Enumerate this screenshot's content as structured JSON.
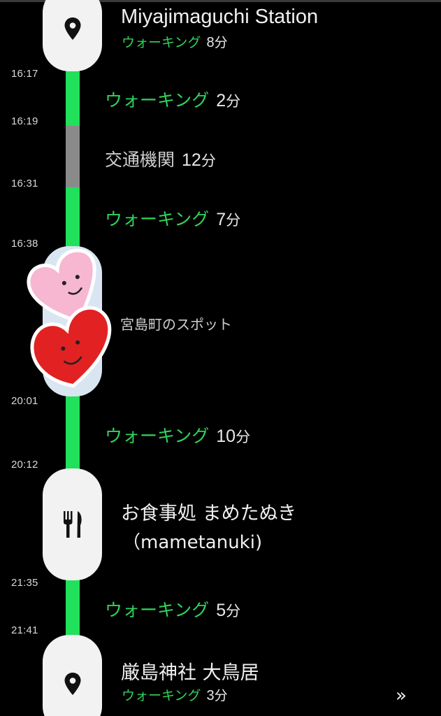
{
  "timeline": {
    "times": [
      "16:17",
      "16:19",
      "16:31",
      "16:38",
      "20:01",
      "20:12",
      "21:35",
      "21:41"
    ],
    "start_place": {
      "name": "Miyajimaguchi Station",
      "walk_label": "ウォーキング",
      "walk_minutes": "8",
      "unit": "分",
      "icon": "map-pin-icon"
    },
    "legs": [
      {
        "label": "ウォーキング",
        "minutes": "2",
        "unit": "分",
        "mode": "walk"
      },
      {
        "label": "交通機関",
        "minutes": "12",
        "unit": "分",
        "mode": "transit"
      },
      {
        "label": "ウォーキング",
        "minutes": "7",
        "unit": "分",
        "mode": "walk"
      },
      {
        "label": "ウォーキング",
        "minutes": "10",
        "unit": "分",
        "mode": "walk"
      },
      {
        "label": "ウォーキング",
        "minutes": "5",
        "unit": "分",
        "mode": "walk"
      }
    ],
    "spot": {
      "name": "宮島町のスポット",
      "icon": "heart-sticker-icon"
    },
    "restaurant": {
      "name_line1": "お食事処 まめたぬき",
      "name_line2": "（mametanuki)",
      "icon": "fork-knife-icon"
    },
    "end_place": {
      "name": "厳島神社 大鳥居",
      "walk_label": "ウォーキング",
      "walk_minutes": "3",
      "unit": "分",
      "icon": "map-pin-icon"
    },
    "more": "»"
  },
  "colors": {
    "background": "#000000",
    "walk_track": "#21e05a",
    "walk_text": "#2fd45a",
    "transit_track": "#8a8a8a",
    "pill": "#f2f2f2"
  }
}
